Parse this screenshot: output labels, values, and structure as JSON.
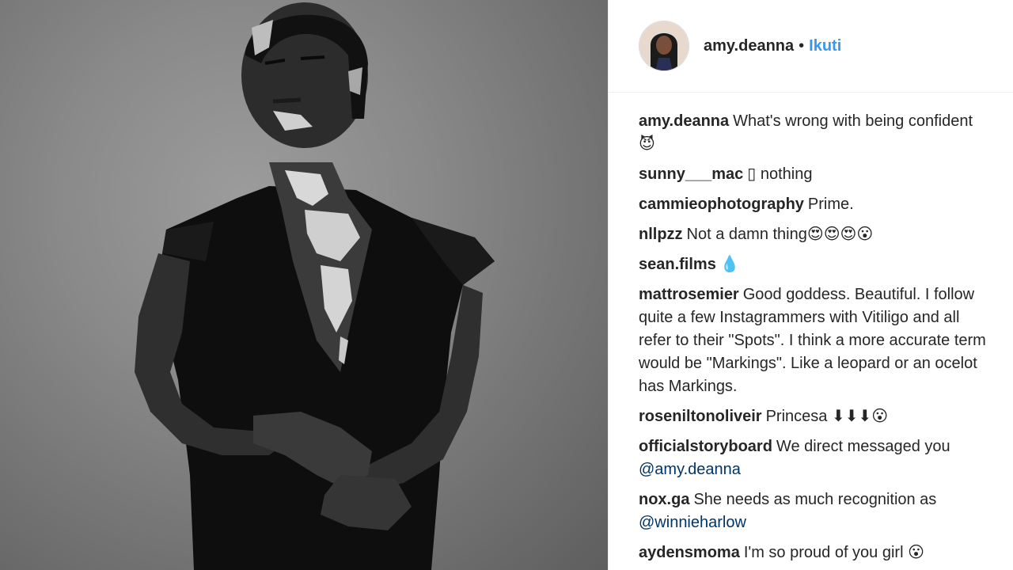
{
  "post": {
    "username": "amy.deanna",
    "separator": "•",
    "follow_label": "Ikuti"
  },
  "comments": [
    {
      "user": "amy.deanna",
      "text": "What's wrong with being confident 😈"
    },
    {
      "user": "sunny___mac",
      "text": "▯ nothing"
    },
    {
      "user": "cammieophotography",
      "text": "Prime."
    },
    {
      "user": "nllpzz",
      "text": "Not a damn thing😍😍😍😮"
    },
    {
      "user": "sean.films",
      "text": "💧"
    },
    {
      "user": "mattrosemier",
      "text": "Good goddess. Beautiful. I follow quite a few Instagrammers with Vitiligo and all refer to their \"Spots\". I think a more accurate term would be \"Markings\". Like a leopard or an ocelot has Markings."
    },
    {
      "user": "roseniltonoliveir",
      "text": "Princesa ⬇⬇⬇😮"
    },
    {
      "user": "officialstoryboard",
      "text": "We direct messaged you",
      "mention": "@amy.deanna"
    },
    {
      "user": "nox.ga",
      "text": "She needs as much recognition as",
      "mention": "@winnieharlow"
    },
    {
      "user": "aydensmoma",
      "text": "I'm so proud of you girl 😮"
    }
  ],
  "icons": {
    "avatar": "profile-avatar"
  }
}
